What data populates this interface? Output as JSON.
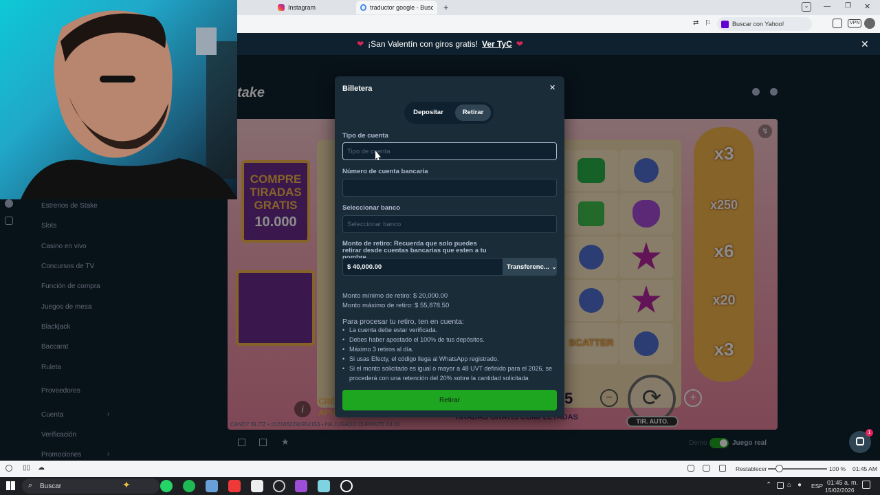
{
  "browser": {
    "tabs": [
      {
        "label": "Instagram"
      },
      {
        "label": "traductor google - Buscar c"
      }
    ],
    "yahoo_placeholder": "Buscar con Yahoo!",
    "vpn_label": "VPN"
  },
  "promo": {
    "text": "¡San Valentín con giros gratis!",
    "link": "Ver TyC"
  },
  "sidebar": {
    "items": [
      {
        "label": "Estrenos de Stake"
      },
      {
        "label": "Slots"
      },
      {
        "label": "Casino en vivo"
      },
      {
        "label": "Concursos de TV"
      },
      {
        "label": "Función de compra"
      },
      {
        "label": "Juegos de mesa"
      },
      {
        "label": "Blackjack"
      },
      {
        "label": "Baccarat"
      },
      {
        "label": "Ruleta"
      },
      {
        "label": "Proveedores"
      },
      {
        "label": "Cuenta"
      },
      {
        "label": "Verificación"
      },
      {
        "label": "Promociones"
      }
    ]
  },
  "game": {
    "buy_line1": "COMPRE",
    "buy_line2": "TIRADAS",
    "buy_line3": "GRATIS",
    "buy_price": "10.000",
    "multipliers": [
      "x3",
      "x250",
      "x6",
      "x20",
      "x3"
    ],
    "scatter": "SCATTER",
    "auto_label": "TIR. AUTO.",
    "banner": "TIRADAS GRATIS COMPLETADAS",
    "credit_partial": "CRÉ",
    "apu_partial": "APU",
    "bet_partial": "5",
    "footer_info": "CANDY BLITZ • #12186229095​4153 • HA JUGADO DURANTE 04:01",
    "demo_label": "Demo",
    "real_label": "Juego real"
  },
  "modal": {
    "title": "Billetera",
    "tab_deposit": "Depositar",
    "tab_withdraw": "Retirar",
    "account_type_label": "Tipo de cuenta",
    "account_type_placeholder": "Tipo de cuenta",
    "account_number_label": "Número de cuenta bancaria",
    "bank_label": "Seleccionar banco",
    "bank_placeholder": "Seleccionar banco",
    "amount_label": "Monto de retiro: Recuerda que solo puedes retirar desde cuentas bancarias que esten a tu nombre",
    "amount_value": "$ 40,000.00",
    "method_value": "Transferenc...",
    "min_text": "Monto mínimo de retiro: $ 20,000.00",
    "max_text": "Monto máximo de retiro: $ 55,878.50",
    "notes_title": "Para procesar tu retiro, ten en cuenta:",
    "notes": [
      "La cuenta debe estar verificada.",
      "Debes haber apostado el 100% de tus depósitos.",
      "Máximo 3 retiros al día.",
      "Si usas Efecty, el código llega al WhatsApp registrado.",
      "Si el monto solicitado es igual o mayor a 48 UVT definido para el 2026, se procederá con una retención del 20% sobre la cantidad solicitada"
    ],
    "submit_label": "Retirar"
  },
  "statusbar": {
    "reset_label": "Restablecer",
    "zoom": "100 %",
    "time": "01:45 AM"
  },
  "taskbar": {
    "search_label": "Buscar",
    "lang": "ESP",
    "time": "01:45 a. m.",
    "date": "15/02/2026"
  },
  "chat_badge": "1",
  "brand_partial": "take",
  "colors": {
    "bg": "#0f212e",
    "panel": "#1a2c38",
    "accent_green": "#1fa621",
    "text_muted": "#b1bad3"
  }
}
